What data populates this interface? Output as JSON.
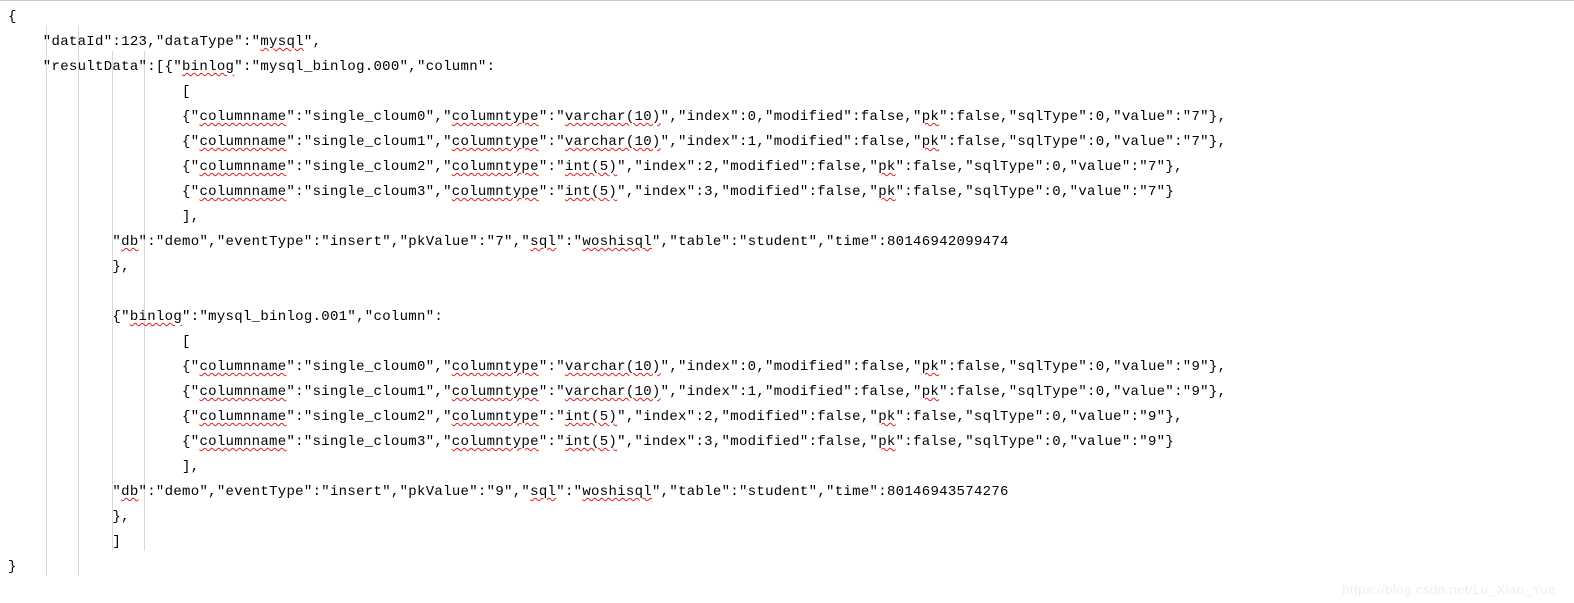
{
  "code": {
    "dataId": 123,
    "dataType": "mysql",
    "resultData": [
      {
        "binlog": "mysql_binlog.000",
        "column": [
          {
            "columnname": "single_cloum0",
            "columntype": "varchar(10)",
            "index": 0,
            "modified": false,
            "pk": false,
            "sqlType": 0,
            "value": "7"
          },
          {
            "columnname": "single_cloum1",
            "columntype": "varchar(10)",
            "index": 1,
            "modified": false,
            "pk": false,
            "sqlType": 0,
            "value": "7"
          },
          {
            "columnname": "single_cloum2",
            "columntype": "int(5)",
            "index": 2,
            "modified": false,
            "pk": false,
            "sqlType": 0,
            "value": "7"
          },
          {
            "columnname": "single_cloum3",
            "columntype": "int(5)",
            "index": 3,
            "modified": false,
            "pk": false,
            "sqlType": 0,
            "value": "7"
          }
        ],
        "db": "demo",
        "eventType": "insert",
        "pkValue": "7",
        "sql": "woshisql",
        "table": "student",
        "time": 80146942099474
      },
      {
        "binlog": "mysql_binlog.001",
        "column": [
          {
            "columnname": "single_cloum0",
            "columntype": "varchar(10)",
            "index": 0,
            "modified": false,
            "pk": false,
            "sqlType": 0,
            "value": "9"
          },
          {
            "columnname": "single_cloum1",
            "columntype": "varchar(10)",
            "index": 1,
            "modified": false,
            "pk": false,
            "sqlType": 0,
            "value": "9"
          },
          {
            "columnname": "single_cloum2",
            "columntype": "int(5)",
            "index": 2,
            "modified": false,
            "pk": false,
            "sqlType": 0,
            "value": "9"
          },
          {
            "columnname": "single_cloum3",
            "columntype": "int(5)",
            "index": 3,
            "modified": false,
            "pk": false,
            "sqlType": 0,
            "value": "9"
          }
        ],
        "db": "demo",
        "eventType": "insert",
        "pkValue": "9",
        "sql": "woshisql",
        "table": "student",
        "time": 80146943574276
      }
    ]
  },
  "spellErrors": [
    "mysql",
    "binlog",
    "columnname",
    "columntype",
    "varchar",
    "pk",
    "int",
    "db",
    "sql",
    "woshisql"
  ],
  "watermark": "https://blog.csdn.net/Lu_Xiao_Yue",
  "lines": {
    "l1": "{",
    "l2_a": "    \"dataId\":",
    "l2_b": ",\"dataType\":\"",
    "l2_c": "\",",
    "l3_a": "    \"resultData\":[{\"",
    "l3_b": "\":\"",
    "l3_c": "\",\"column\":",
    "l4": "                    [",
    "colIndent": "                    {\"",
    "colSep1": "\":\"",
    "colSep2": "\",\"",
    "colSep2b": "\":\"",
    "colSep3": "\",\"index\":",
    "colSep4": ",\"modified\":",
    "colSep5": ",\"",
    "colSep6": "\":",
    "colSep7": ",\"sqlType\":",
    "colSep8": ",\"value\":\"",
    "colEndC": "\"},",
    "colEnd": "\"}",
    "l9": "                    ],",
    "sum_a": "            \"",
    "sum_b": "\":\"",
    "sum_c": "\",\"eventType\":\"",
    "sum_d": "\",\"pkValue\":\"",
    "sum_e": "\",\"",
    "sum_e2": "\":\"",
    "sum_f": "\",\"table\":\"",
    "sum_g": "\",\"time\":",
    "l11": "            },",
    "blank": "",
    "l13_a": "            {\"",
    "l13_b": "\":\"",
    "l13_c": "\",\"column\":",
    "l22": "            ]",
    "l23": "}",
    "false": "false"
  }
}
